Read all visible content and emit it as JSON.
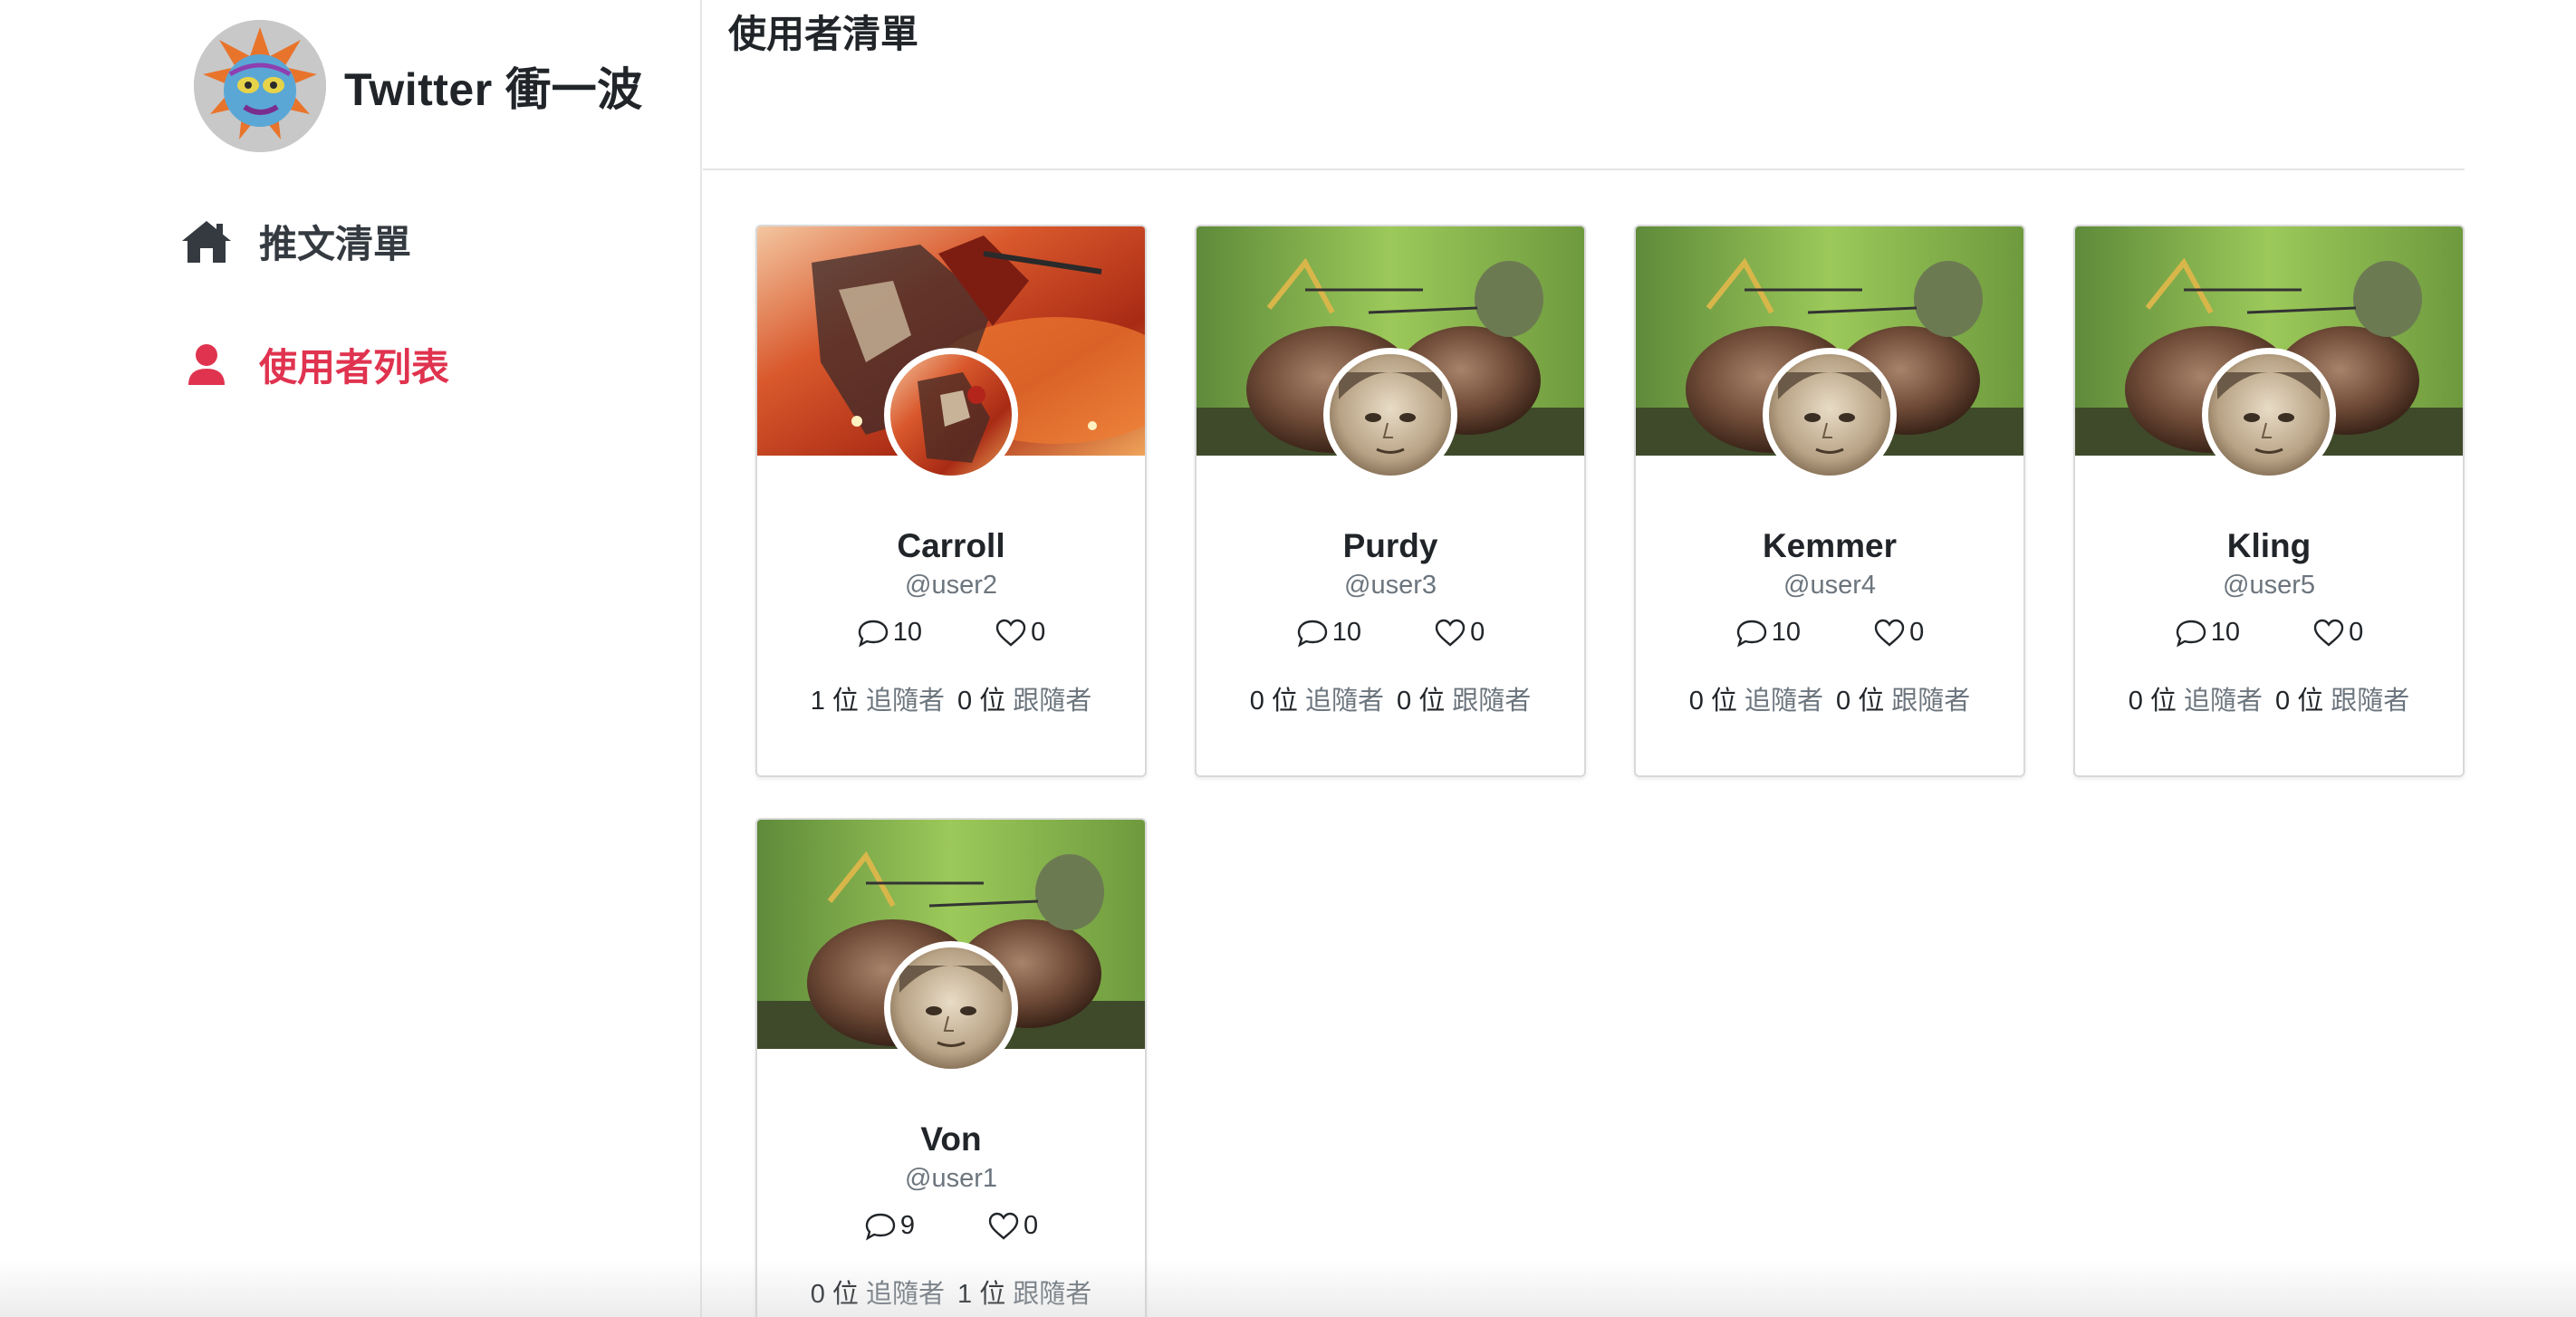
{
  "brand": {
    "title": "Twitter 衝一波",
    "avatar_icon": "cartoon-avatar-icon"
  },
  "nav": [
    {
      "label": "推文清單",
      "icon": "home-icon",
      "color": "#343a40",
      "active": false
    },
    {
      "label": "使用者列表",
      "icon": "user-icon",
      "color": "#e0334f",
      "active": true
    }
  ],
  "main": {
    "title": "使用者清單"
  },
  "labels": {
    "unit": "位",
    "followers": "追隨者",
    "following": "跟隨者"
  },
  "users": [
    {
      "name": "Carroll",
      "handle": "@user2",
      "tweets": "10",
      "likes": "0",
      "followers": "1",
      "following": "0",
      "cover": "anime-fire-cover"
    },
    {
      "name": "Purdy",
      "handle": "@user3",
      "tweets": "10",
      "likes": "0",
      "followers": "0",
      "following": "0",
      "cover": "snail-frog-cover"
    },
    {
      "name": "Kemmer",
      "handle": "@user4",
      "tweets": "10",
      "likes": "0",
      "followers": "0",
      "following": "0",
      "cover": "snail-frog-cover"
    },
    {
      "name": "Kling",
      "handle": "@user5",
      "tweets": "10",
      "likes": "0",
      "followers": "0",
      "following": "0",
      "cover": "snail-frog-cover"
    },
    {
      "name": "Von",
      "handle": "@user1",
      "tweets": "9",
      "likes": "0",
      "followers": "0",
      "following": "1",
      "cover": "snail-frog-cover"
    }
  ],
  "colors": {
    "accent": "#e0334f",
    "muted": "#6c757d",
    "text": "#212529"
  }
}
